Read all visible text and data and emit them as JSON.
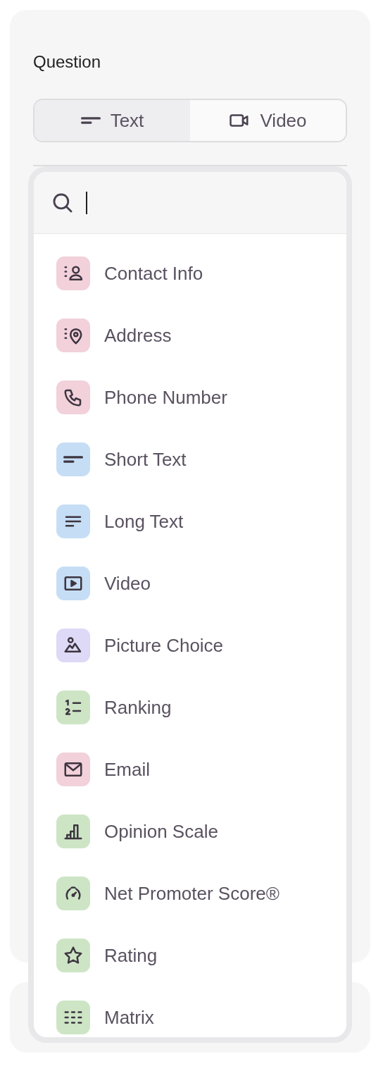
{
  "title": "Question",
  "tabs": [
    {
      "label": "Text",
      "kind": "text",
      "selected": true
    },
    {
      "label": "Video",
      "kind": "video",
      "selected": false
    }
  ],
  "search": {
    "focused": true
  },
  "items": [
    {
      "label": "Contact Info",
      "kind": "contact",
      "color": "#f2d1db"
    },
    {
      "label": "Address",
      "kind": "address",
      "color": "#f2d1db"
    },
    {
      "label": "Phone Number",
      "kind": "phone",
      "color": "#f2d1db"
    },
    {
      "label": "Short Text",
      "kind": "short",
      "color": "#c6def5"
    },
    {
      "label": "Long Text",
      "kind": "long",
      "color": "#c6def5"
    },
    {
      "label": "Video",
      "kind": "video",
      "color": "#c6def5"
    },
    {
      "label": "Picture Choice",
      "kind": "picture",
      "color": "#ddd9f6"
    },
    {
      "label": "Ranking",
      "kind": "ranking",
      "color": "#cde5c5"
    },
    {
      "label": "Email",
      "kind": "email",
      "color": "#f2d1db"
    },
    {
      "label": "Opinion Scale",
      "kind": "scale",
      "color": "#cde5c5"
    },
    {
      "label": "Net Promoter Score®",
      "kind": "nps",
      "color": "#cde5c5"
    },
    {
      "label": "Rating",
      "kind": "rating",
      "color": "#cde5c5"
    },
    {
      "label": "Matrix",
      "kind": "matrix",
      "color": "#cde5c5"
    }
  ]
}
